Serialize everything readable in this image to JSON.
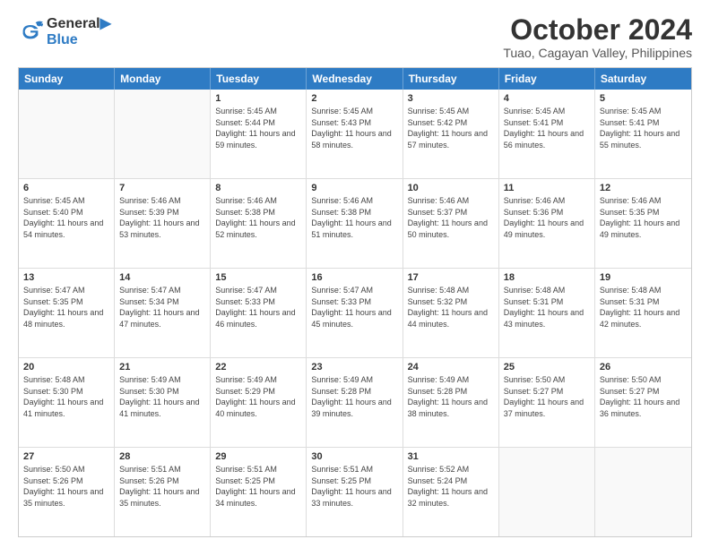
{
  "logo": {
    "line1": "General",
    "line2": "Blue"
  },
  "title": "October 2024",
  "location": "Tuao, Cagayan Valley, Philippines",
  "header_days": [
    "Sunday",
    "Monday",
    "Tuesday",
    "Wednesday",
    "Thursday",
    "Friday",
    "Saturday"
  ],
  "weeks": [
    [
      {
        "day": "",
        "info": ""
      },
      {
        "day": "",
        "info": ""
      },
      {
        "day": "1",
        "info": "Sunrise: 5:45 AM\nSunset: 5:44 PM\nDaylight: 11 hours and 59 minutes."
      },
      {
        "day": "2",
        "info": "Sunrise: 5:45 AM\nSunset: 5:43 PM\nDaylight: 11 hours and 58 minutes."
      },
      {
        "day": "3",
        "info": "Sunrise: 5:45 AM\nSunset: 5:42 PM\nDaylight: 11 hours and 57 minutes."
      },
      {
        "day": "4",
        "info": "Sunrise: 5:45 AM\nSunset: 5:41 PM\nDaylight: 11 hours and 56 minutes."
      },
      {
        "day": "5",
        "info": "Sunrise: 5:45 AM\nSunset: 5:41 PM\nDaylight: 11 hours and 55 minutes."
      }
    ],
    [
      {
        "day": "6",
        "info": "Sunrise: 5:45 AM\nSunset: 5:40 PM\nDaylight: 11 hours and 54 minutes."
      },
      {
        "day": "7",
        "info": "Sunrise: 5:46 AM\nSunset: 5:39 PM\nDaylight: 11 hours and 53 minutes."
      },
      {
        "day": "8",
        "info": "Sunrise: 5:46 AM\nSunset: 5:38 PM\nDaylight: 11 hours and 52 minutes."
      },
      {
        "day": "9",
        "info": "Sunrise: 5:46 AM\nSunset: 5:38 PM\nDaylight: 11 hours and 51 minutes."
      },
      {
        "day": "10",
        "info": "Sunrise: 5:46 AM\nSunset: 5:37 PM\nDaylight: 11 hours and 50 minutes."
      },
      {
        "day": "11",
        "info": "Sunrise: 5:46 AM\nSunset: 5:36 PM\nDaylight: 11 hours and 49 minutes."
      },
      {
        "day": "12",
        "info": "Sunrise: 5:46 AM\nSunset: 5:35 PM\nDaylight: 11 hours and 49 minutes."
      }
    ],
    [
      {
        "day": "13",
        "info": "Sunrise: 5:47 AM\nSunset: 5:35 PM\nDaylight: 11 hours and 48 minutes."
      },
      {
        "day": "14",
        "info": "Sunrise: 5:47 AM\nSunset: 5:34 PM\nDaylight: 11 hours and 47 minutes."
      },
      {
        "day": "15",
        "info": "Sunrise: 5:47 AM\nSunset: 5:33 PM\nDaylight: 11 hours and 46 minutes."
      },
      {
        "day": "16",
        "info": "Sunrise: 5:47 AM\nSunset: 5:33 PM\nDaylight: 11 hours and 45 minutes."
      },
      {
        "day": "17",
        "info": "Sunrise: 5:48 AM\nSunset: 5:32 PM\nDaylight: 11 hours and 44 minutes."
      },
      {
        "day": "18",
        "info": "Sunrise: 5:48 AM\nSunset: 5:31 PM\nDaylight: 11 hours and 43 minutes."
      },
      {
        "day": "19",
        "info": "Sunrise: 5:48 AM\nSunset: 5:31 PM\nDaylight: 11 hours and 42 minutes."
      }
    ],
    [
      {
        "day": "20",
        "info": "Sunrise: 5:48 AM\nSunset: 5:30 PM\nDaylight: 11 hours and 41 minutes."
      },
      {
        "day": "21",
        "info": "Sunrise: 5:49 AM\nSunset: 5:30 PM\nDaylight: 11 hours and 41 minutes."
      },
      {
        "day": "22",
        "info": "Sunrise: 5:49 AM\nSunset: 5:29 PM\nDaylight: 11 hours and 40 minutes."
      },
      {
        "day": "23",
        "info": "Sunrise: 5:49 AM\nSunset: 5:28 PM\nDaylight: 11 hours and 39 minutes."
      },
      {
        "day": "24",
        "info": "Sunrise: 5:49 AM\nSunset: 5:28 PM\nDaylight: 11 hours and 38 minutes."
      },
      {
        "day": "25",
        "info": "Sunrise: 5:50 AM\nSunset: 5:27 PM\nDaylight: 11 hours and 37 minutes."
      },
      {
        "day": "26",
        "info": "Sunrise: 5:50 AM\nSunset: 5:27 PM\nDaylight: 11 hours and 36 minutes."
      }
    ],
    [
      {
        "day": "27",
        "info": "Sunrise: 5:50 AM\nSunset: 5:26 PM\nDaylight: 11 hours and 35 minutes."
      },
      {
        "day": "28",
        "info": "Sunrise: 5:51 AM\nSunset: 5:26 PM\nDaylight: 11 hours and 35 minutes."
      },
      {
        "day": "29",
        "info": "Sunrise: 5:51 AM\nSunset: 5:25 PM\nDaylight: 11 hours and 34 minutes."
      },
      {
        "day": "30",
        "info": "Sunrise: 5:51 AM\nSunset: 5:25 PM\nDaylight: 11 hours and 33 minutes."
      },
      {
        "day": "31",
        "info": "Sunrise: 5:52 AM\nSunset: 5:24 PM\nDaylight: 11 hours and 32 minutes."
      },
      {
        "day": "",
        "info": ""
      },
      {
        "day": "",
        "info": ""
      }
    ]
  ]
}
